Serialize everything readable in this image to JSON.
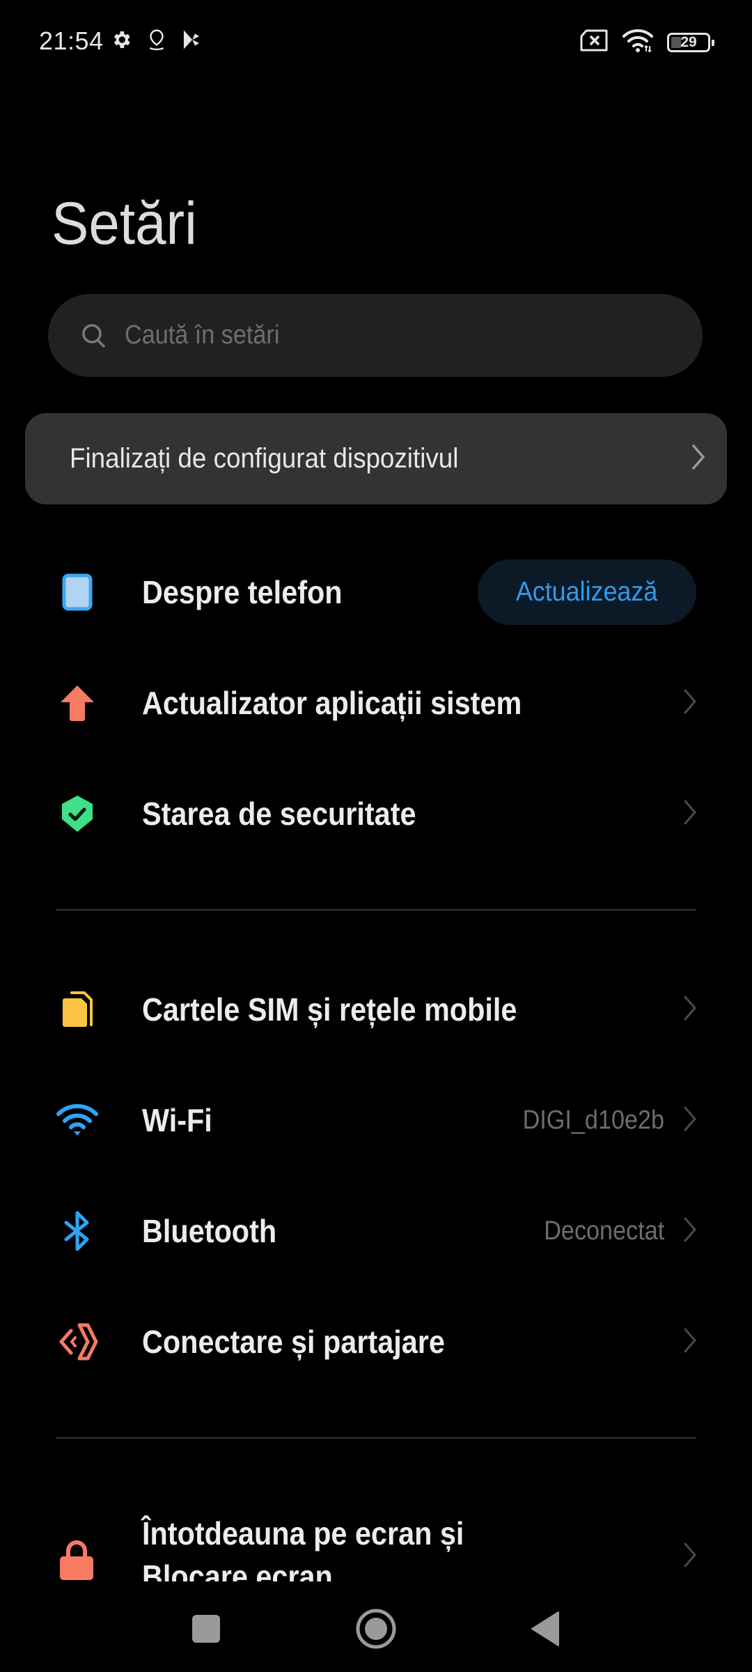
{
  "status_bar": {
    "time": "21:54",
    "left_icons": [
      "settings-gear-icon",
      "location-pin-icon",
      "play-store-icon"
    ],
    "right_icons": [
      "no-sim-icon",
      "wifi-icon",
      "battery-icon"
    ],
    "battery_level": "29",
    "battery_fraction": 0.29
  },
  "header": {
    "title": "Setări"
  },
  "search": {
    "placeholder": "Caută în setări",
    "value": ""
  },
  "setup_card": {
    "label": "Finalizați de configurat dispozitivul"
  },
  "section1": [
    {
      "label": "Despre telefon",
      "icon": "phone-icon",
      "icon_color": "#3aa8f5",
      "action_label": "Actualizează"
    },
    {
      "label": "Actualizator aplicații sistem",
      "icon": "arrow-up-icon",
      "icon_color": "#f77a63"
    },
    {
      "label": "Starea de securitate",
      "icon": "shield-check-icon",
      "icon_color": "#3ee089"
    }
  ],
  "section2": [
    {
      "label": "Cartele SIM și rețele mobile",
      "icon": "sim-cards-icon",
      "icon_color": "#fec443",
      "value": ""
    },
    {
      "label": "Wi-Fi",
      "icon": "wifi-icon",
      "icon_color": "#2ea4f6",
      "value": "DIGI_d10e2b"
    },
    {
      "label": "Bluetooth",
      "icon": "bluetooth-icon",
      "icon_color": "#2ea4f6",
      "value": "Deconectat"
    },
    {
      "label": "Conectare și partajare",
      "icon": "connection-share-icon",
      "icon_color": "#f77a63",
      "value": ""
    }
  ],
  "section3": [
    {
      "label_line1": "Întotdeauna pe ecran și",
      "label_line2": "Blocare ecran",
      "icon": "lock-icon",
      "icon_color": "#f77a63"
    }
  ],
  "navbar": {
    "buttons": [
      "recents-button",
      "home-button",
      "back-button"
    ]
  },
  "colors": {
    "accent": "#2e9bf0",
    "background": "#000000",
    "card": "#333333",
    "search_bg": "#212121"
  }
}
